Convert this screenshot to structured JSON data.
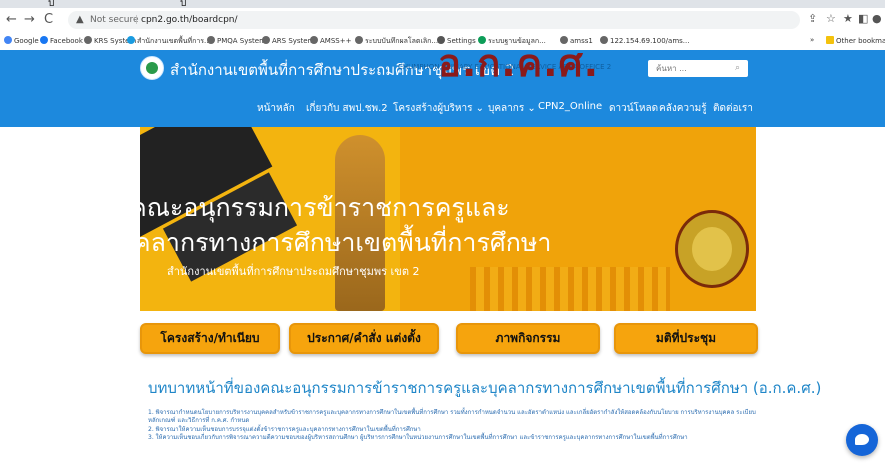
{
  "browser": {
    "url_warning": "Not secure",
    "url": "cpn2.go.th/boardcpn/",
    "bookmarks": [
      "Google",
      "Facebook",
      "KRS System",
      "สำนักงานเขตพื้นที่การ...",
      "PMQA System",
      "ARS System",
      "AMSS++",
      "ระบบบันทึกผลโลตเลิก...",
      "Settings",
      "ระบบฐานข้อมูลก...",
      "amss1",
      "122.154.69.100/ams..."
    ],
    "other_bookmarks": "Other bookmar",
    "overflow": "»"
  },
  "header": {
    "title": "สำนักงานเขตพื้นที่การศึกษาประถมศึกษาชุมพร เขต 2",
    "subtitle_en": "CHUMPHON PRIMARY EDUCATIONAL SERVICE AREA OFFICE 2",
    "search_placeholder": "ค้นหา ..."
  },
  "menu": [
    "หน้าหลัก",
    "เกี่ยวกับ สพป.ชพ.2",
    "โครงสร้างผู้บริหาร ⌄",
    "บุคลากร ⌄",
    "CPN2_Online",
    "ดาวน์โหลด",
    "คลังความรู้",
    "ติดต่อเรา"
  ],
  "banner": {
    "line1": "อ.ก.ค.ศ.",
    "line2": "คณะอนุกรรมการข้าราชการครูและ",
    "line3": "บุคลากรทางการศึกษาเขตพื้นที่การศึกษา",
    "line4": "สำนักงานเขตพื้นที่การศึกษาประถมศึกษาชุมพร เขต 2"
  },
  "buttons": [
    "โครงสร้าง/ทำเนียบ",
    "ประกาศ/คำสั่ง แต่งตั้ง",
    "ภาพกิจกรรม",
    "มติที่ประชุม"
  ],
  "heading": "บทบาทหน้าที่ของคณะอนุกรรมการข้าราชการครูและบุคลากรทางการศึกษาเขตพื้นที่การศึกษา (อ.ก.ค.ศ.)",
  "paragraphs": [
    "1. พิจารณากำหนดนโยบายการบริหารงานบุคคลสำหรับข้าราชการครูและบุคลากรทางการศึกษาในเขตพื้นที่การศึกษา รวมทั้งการกำหนดจำนวน และอัตราตำแหน่ง และเกลี่ยอัตรากำลังให้สอดคล้องกับนโยบาย การบริหารงานบุคคล ระเบียบ หลักเกณฑ์ และวิธีการที่ ก.ค.ศ. กำหนด",
    "2. พิจารณาให้ความเห็นชอบการบรรจุแต่งตั้งข้าราชการครูและบุคลากรทางการศึกษาในเขตพื้นที่การศึกษา",
    "3. ให้ความเห็นชอบเกี่ยวกับการพิจารณาความดีความชอบของผู้บริหารสถานศึกษา ผู้บริหารการศึกษาในหน่วยงานการศึกษาในเขตพื้นที่การศึกษา และข้าราชการครูและบุคลากรทางการศึกษาในเขตพื้นที่การศึกษา"
  ]
}
